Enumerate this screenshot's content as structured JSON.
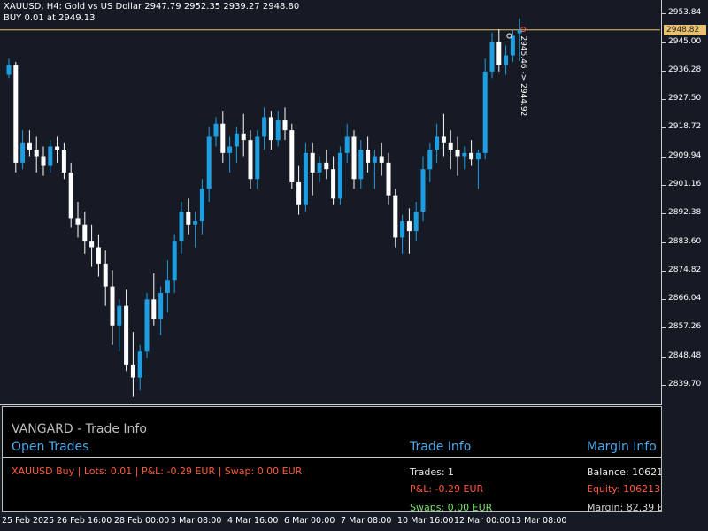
{
  "header": {
    "line1": "XAUUSD, H4:  Gold vs US Dollar  2947.79 2952.35 2939.27 2948.80",
    "line2": "BUY 0.01 at 2949.13"
  },
  "price_axis": {
    "current_price": "2948.82",
    "labels": [
      "2953.84",
      "2945.00",
      "2936.28",
      "2927.50",
      "2918.72",
      "2909.94",
      "2901.16",
      "2892.38",
      "2883.60",
      "2874.82",
      "2866.04",
      "2857.26",
      "2848.48",
      "2839.70"
    ]
  },
  "time_axis": {
    "labels": [
      "25 Feb 2025",
      "26 Feb 16:00",
      "28 Feb 00:00",
      "3 Mar 08:00",
      "4 Mar 16:00",
      "6 Mar 00:00",
      "7 Mar 08:00",
      "10 Mar 16:00",
      "12 Mar 00:00",
      "13 Mar 08:00"
    ]
  },
  "annotations": {
    "trade_line_label": "2945.46 -> 2944.92"
  },
  "panel": {
    "title": "VANGARD - Trade Info",
    "open_trades_title": "Open Trades",
    "trade_info_title": "Trade Info",
    "margin_info_title": "Margin Info",
    "open_trade_row": "XAUUSD Buy | Lots: 0.01 | P&L: -0.29 EUR | Swap: 0.00 EUR",
    "trades": "Trades: 1",
    "pnl": "P&L: -0.29 EUR",
    "swaps": "Swaps: 0.00 EUR",
    "balance": "Balance: 10621",
    "equity": "Equity: 106213.",
    "margin": "Margin: 82.39 E"
  },
  "colors": {
    "background": "#151a24",
    "bull_candle": "#1e9de0",
    "bear_candle": "#ffffff",
    "current_price_line": "#e8c070",
    "loss_text": "#ff5a3c",
    "swap_text": "#7ae06a",
    "section_title": "#4aa8e8"
  },
  "chart_data": {
    "type": "candlestick",
    "symbol": "XAUUSD",
    "timeframe": "H4",
    "ohlc": [
      [
        2935,
        2940,
        2934,
        2938
      ],
      [
        2938,
        2939,
        2905,
        2908
      ],
      [
        2908,
        2918,
        2906,
        2914
      ],
      [
        2914,
        2918,
        2910,
        2912
      ],
      [
        2912,
        2916,
        2905,
        2910
      ],
      [
        2910,
        2913,
        2904,
        2907
      ],
      [
        2907,
        2915,
        2905,
        2913
      ],
      [
        2913,
        2916,
        2908,
        2912
      ],
      [
        2912,
        2914,
        2903,
        2905
      ],
      [
        2905,
        2908,
        2888,
        2891
      ],
      [
        2891,
        2896,
        2885,
        2889
      ],
      [
        2889,
        2893,
        2880,
        2884
      ],
      [
        2884,
        2889,
        2876,
        2882
      ],
      [
        2882,
        2886,
        2873,
        2877
      ],
      [
        2877,
        2881,
        2864,
        2870
      ],
      [
        2870,
        2875,
        2852,
        2858
      ],
      [
        2858,
        2866,
        2850,
        2864
      ],
      [
        2864,
        2869,
        2844,
        2846
      ],
      [
        2846,
        2856,
        2836,
        2842
      ],
      [
        2842,
        2852,
        2838,
        2850
      ],
      [
        2850,
        2868,
        2848,
        2866
      ],
      [
        2866,
        2874,
        2858,
        2860
      ],
      [
        2860,
        2870,
        2855,
        2868
      ],
      [
        2868,
        2878,
        2862,
        2872
      ],
      [
        2872,
        2886,
        2868,
        2884
      ],
      [
        2884,
        2896,
        2880,
        2893
      ],
      [
        2893,
        2897,
        2886,
        2889
      ],
      [
        2889,
        2893,
        2882,
        2890
      ],
      [
        2890,
        2903,
        2886,
        2900
      ],
      [
        2900,
        2919,
        2896,
        2916
      ],
      [
        2916,
        2922,
        2913,
        2920
      ],
      [
        2920,
        2924,
        2908,
        2911
      ],
      [
        2911,
        2916,
        2905,
        2913
      ],
      [
        2913,
        2919,
        2908,
        2917
      ],
      [
        2917,
        2923,
        2910,
        2915
      ],
      [
        2915,
        2918,
        2900,
        2903
      ],
      [
        2903,
        2918,
        2900,
        2916
      ],
      [
        2916,
        2925,
        2912,
        2922
      ],
      [
        2922,
        2924,
        2912,
        2915
      ],
      [
        2915,
        2924,
        2913,
        2921
      ],
      [
        2921,
        2925,
        2915,
        2918
      ],
      [
        2918,
        2920,
        2900,
        2902
      ],
      [
        2902,
        2907,
        2892,
        2895
      ],
      [
        2895,
        2914,
        2893,
        2911
      ],
      [
        2911,
        2914,
        2898,
        2905
      ],
      [
        2905,
        2910,
        2902,
        2908
      ],
      [
        2908,
        2912,
        2903,
        2906
      ],
      [
        2906,
        2910,
        2895,
        2897
      ],
      [
        2897,
        2913,
        2895,
        2911
      ],
      [
        2911,
        2920,
        2908,
        2916
      ],
      [
        2916,
        2918,
        2900,
        2903
      ],
      [
        2903,
        2915,
        2900,
        2912
      ],
      [
        2912,
        2916,
        2905,
        2908
      ],
      [
        2908,
        2912,
        2900,
        2910
      ],
      [
        2910,
        2914,
        2904,
        2908
      ],
      [
        2908,
        2911,
        2895,
        2898
      ],
      [
        2898,
        2900,
        2882,
        2885
      ],
      [
        2885,
        2892,
        2880,
        2890
      ],
      [
        2890,
        2894,
        2880,
        2887
      ],
      [
        2887,
        2896,
        2884,
        2893
      ],
      [
        2893,
        2910,
        2890,
        2906
      ],
      [
        2906,
        2914,
        2902,
        2912
      ],
      [
        2912,
        2920,
        2908,
        2916
      ],
      [
        2916,
        2923,
        2910,
        2914
      ],
      [
        2914,
        2918,
        2906,
        2912
      ],
      [
        2912,
        2916,
        2904,
        2910
      ],
      [
        2910,
        2913,
        2906,
        2911
      ],
      [
        2911,
        2915,
        2907,
        2909
      ],
      [
        2909,
        2912,
        2900,
        2911
      ],
      [
        2911,
        2940,
        2909,
        2936
      ],
      [
        2936,
        2948,
        2934,
        2945
      ],
      [
        2945,
        2949,
        2936,
        2938
      ],
      [
        2938,
        2944,
        2935,
        2941
      ],
      [
        2941,
        2949,
        2939,
        2947
      ],
      [
        2947.79,
        2952.35,
        2939.27,
        2948.8
      ]
    ],
    "ylim": [
      2834,
      2958
    ],
    "current_price": 2948.82
  }
}
